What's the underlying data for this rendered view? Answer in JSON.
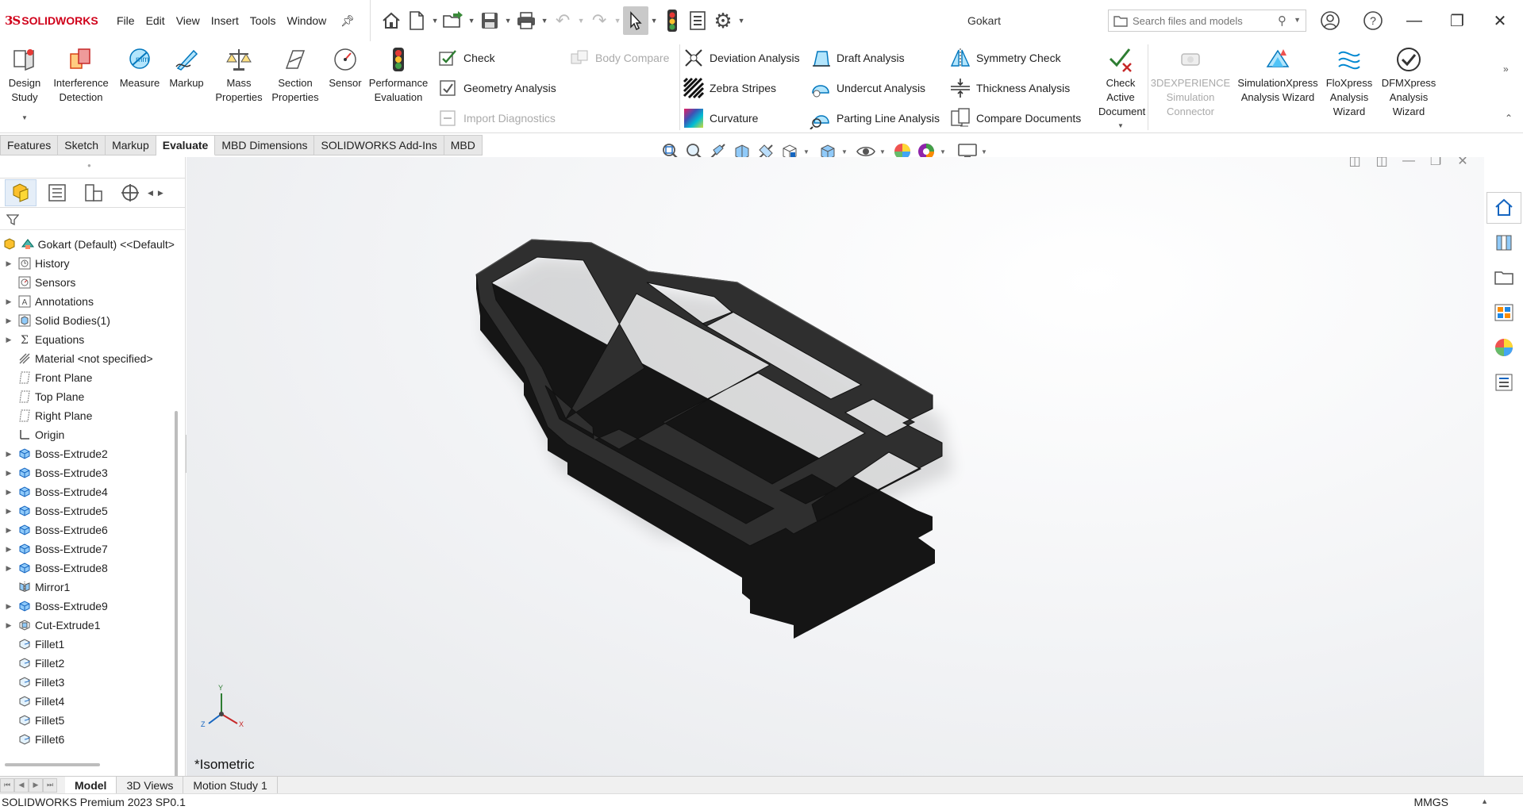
{
  "app": {
    "logo_ds": "3S",
    "logo_text": "SOLIDWORKS",
    "doc_title": "Gokart"
  },
  "menu": [
    "File",
    "Edit",
    "View",
    "Insert",
    "Tools",
    "Window"
  ],
  "search": {
    "placeholder": "Search files and models"
  },
  "ribbon": {
    "big_left": [
      {
        "label": "Design\nStudy",
        "icon": "design-study-icon"
      },
      {
        "label": "Interference\nDetection",
        "icon": "interference-icon"
      },
      {
        "label": "Measure",
        "icon": "measure-icon"
      },
      {
        "label": "Markup",
        "icon": "markup-icon"
      },
      {
        "label": "Mass\nProperties",
        "icon": "mass-properties-icon"
      },
      {
        "label": "Section\nProperties",
        "icon": "section-properties-icon"
      },
      {
        "label": "Sensor",
        "icon": "sensor-icon"
      },
      {
        "label": "Performance\nEvaluation",
        "icon": "performance-icon"
      }
    ],
    "check": "Check",
    "geometry_analysis": "Geometry Analysis",
    "import_diagnostics": "Import Diagnostics",
    "body_compare": "Body Compare",
    "deviation_analysis": "Deviation Analysis",
    "zebra_stripes": "Zebra Stripes",
    "curvature": "Curvature",
    "draft_analysis": "Draft Analysis",
    "undercut_analysis": "Undercut Analysis",
    "parting_line_analysis": "Parting Line Analysis",
    "symmetry_check": "Symmetry Check",
    "thickness_analysis": "Thickness Analysis",
    "compare_documents": "Compare Documents",
    "check_active_document": "Check\nActive\nDocument",
    "big_right": [
      {
        "label": "3DEXPERIENCE\nSimulation\nConnector",
        "disabled": true
      },
      {
        "label": "SimulationXpress\nAnalysis Wizard",
        "disabled": false
      },
      {
        "label": "FloXpress\nAnalysis\nWizard",
        "disabled": false
      },
      {
        "label": "DFMXpress\nAnalysis\nWizard",
        "disabled": false
      }
    ]
  },
  "command_tabs": [
    "Features",
    "Sketch",
    "Markup",
    "Evaluate",
    "MBD Dimensions",
    "SOLIDWORKS Add-Ins",
    "MBD"
  ],
  "active_command_tab": "Evaluate",
  "tree": {
    "root": "Gokart (Default) <<Default>",
    "items": [
      {
        "label": "History",
        "expandable": true,
        "icon": "history-icon"
      },
      {
        "label": "Sensors",
        "expandable": false,
        "icon": "sensors-icon"
      },
      {
        "label": "Annotations",
        "expandable": true,
        "icon": "annotations-icon"
      },
      {
        "label": "Solid Bodies(1)",
        "expandable": true,
        "icon": "solid-bodies-icon"
      },
      {
        "label": "Equations",
        "expandable": true,
        "icon": "equations-icon"
      },
      {
        "label": "Material <not specified>",
        "expandable": false,
        "icon": "material-icon"
      },
      {
        "label": "Front Plane",
        "expandable": false,
        "icon": "plane-icon"
      },
      {
        "label": "Top Plane",
        "expandable": false,
        "icon": "plane-icon"
      },
      {
        "label": "Right Plane",
        "expandable": false,
        "icon": "plane-icon"
      },
      {
        "label": "Origin",
        "expandable": false,
        "icon": "origin-icon"
      },
      {
        "label": "Boss-Extrude2",
        "expandable": true,
        "icon": "extrude-icon"
      },
      {
        "label": "Boss-Extrude3",
        "expandable": true,
        "icon": "extrude-icon"
      },
      {
        "label": "Boss-Extrude4",
        "expandable": true,
        "icon": "extrude-icon"
      },
      {
        "label": "Boss-Extrude5",
        "expandable": true,
        "icon": "extrude-icon"
      },
      {
        "label": "Boss-Extrude6",
        "expandable": true,
        "icon": "extrude-icon"
      },
      {
        "label": "Boss-Extrude7",
        "expandable": true,
        "icon": "extrude-icon"
      },
      {
        "label": "Boss-Extrude8",
        "expandable": true,
        "icon": "extrude-icon"
      },
      {
        "label": "Mirror1",
        "expandable": false,
        "icon": "mirror-icon"
      },
      {
        "label": "Boss-Extrude9",
        "expandable": true,
        "icon": "extrude-icon"
      },
      {
        "label": "Cut-Extrude1",
        "expandable": true,
        "icon": "cut-extrude-icon"
      },
      {
        "label": "Fillet1",
        "expandable": false,
        "icon": "fillet-icon"
      },
      {
        "label": "Fillet2",
        "expandable": false,
        "icon": "fillet-icon"
      },
      {
        "label": "Fillet3",
        "expandable": false,
        "icon": "fillet-icon"
      },
      {
        "label": "Fillet4",
        "expandable": false,
        "icon": "fillet-icon"
      },
      {
        "label": "Fillet5",
        "expandable": false,
        "icon": "fillet-icon"
      },
      {
        "label": "Fillet6",
        "expandable": false,
        "icon": "fillet-icon"
      }
    ]
  },
  "viewport": {
    "view_label": "*Isometric",
    "triad": {
      "y": "Y",
      "x": "X",
      "z": "Z"
    },
    "model_color": "#2f2f2f"
  },
  "bottom_tabs": [
    "Model",
    "3D Views",
    "Motion Study 1"
  ],
  "active_bottom_tab": "Model",
  "status": {
    "product": "SOLIDWORKS Premium 2023 SP0.1",
    "units": "MMGS"
  }
}
